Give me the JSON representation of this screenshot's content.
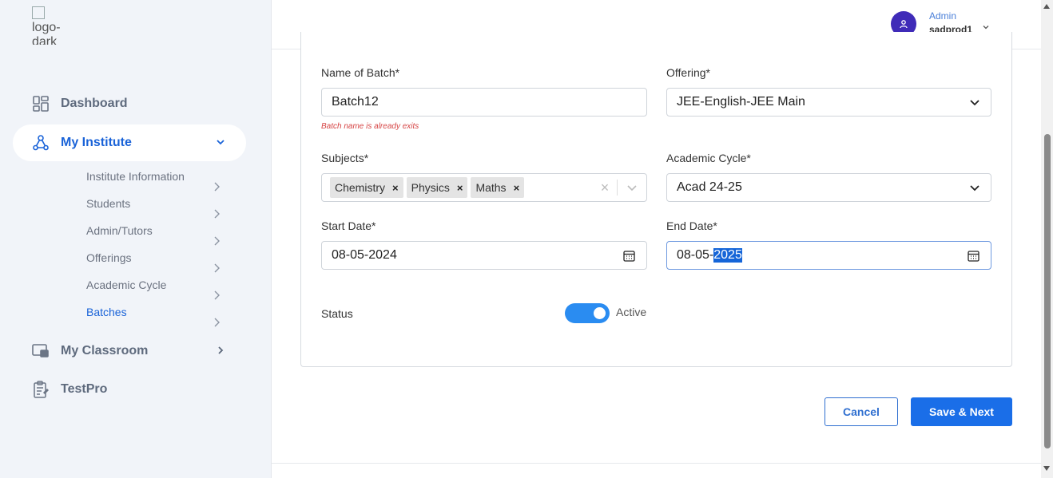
{
  "sidebar": {
    "logo_alt": "logo-dark",
    "nav": [
      {
        "label": "Dashboard",
        "icon": "dashboard-icon"
      },
      {
        "label": "My Institute",
        "icon": "institute-icon"
      },
      {
        "label": "My Classroom",
        "icon": "classroom-icon"
      },
      {
        "label": "TestPro",
        "icon": "testpro-icon"
      }
    ],
    "sub_items": [
      "Institute Information",
      "Students",
      "Admin/Tutors",
      "Offerings",
      "Academic Cycle",
      "Batches"
    ]
  },
  "header": {
    "role": "Admin",
    "username": "sadprod1"
  },
  "form": {
    "batch_name": {
      "label": "Name of Batch*",
      "value": "Batch12",
      "error": "Batch name is already exits"
    },
    "offering": {
      "label": "Offering*",
      "value": "JEE-English-JEE Main"
    },
    "subjects": {
      "label": "Subjects*",
      "chips": [
        "Chemistry",
        "Physics",
        "Maths"
      ]
    },
    "academic_cycle": {
      "label": "Academic Cycle*",
      "value": "Acad 24-25"
    },
    "start_date": {
      "label": "Start Date*",
      "value": "08-05-2024"
    },
    "end_date": {
      "label": "End Date*",
      "value_prefix": "08-05-",
      "value_selected": "2025"
    },
    "status": {
      "label": "Status",
      "toggle_label": "Active",
      "on": true
    }
  },
  "actions": {
    "cancel": "Cancel",
    "save": "Save & Next"
  },
  "colors": {
    "primary": "#1a6ee8",
    "accent_active": "#1a63d8",
    "error": "#d64545",
    "avatar": "#3f2bb8"
  }
}
